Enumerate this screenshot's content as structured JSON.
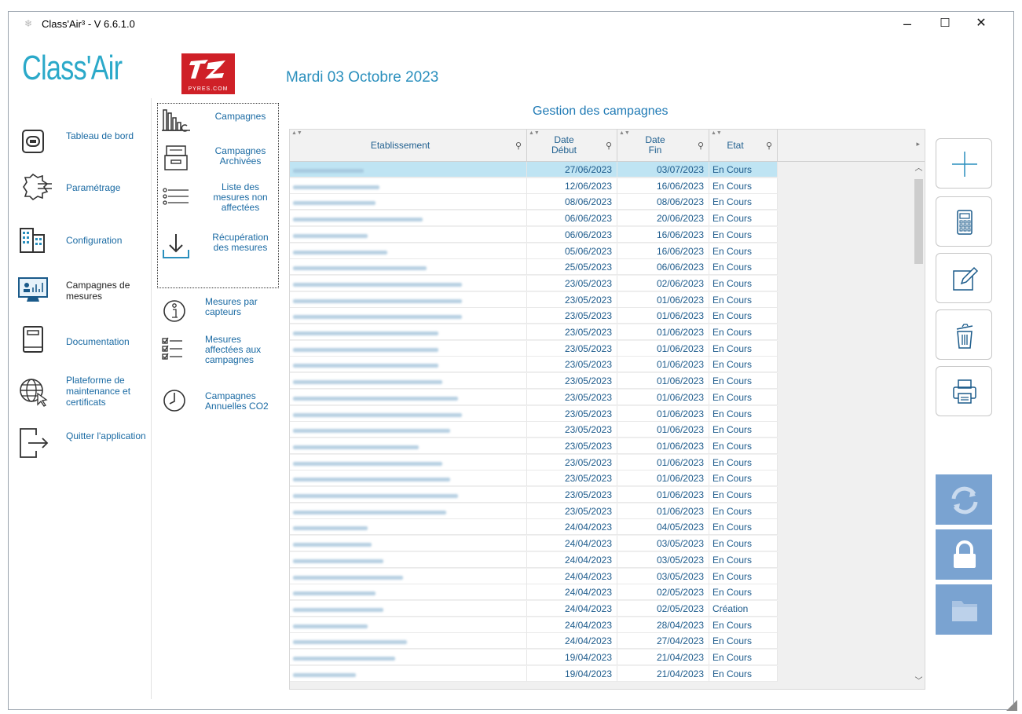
{
  "window": {
    "title": "Class'Air³ - V 6.6.1.0",
    "minimize": "–",
    "maximize": "☐",
    "close": "✕"
  },
  "logo": {
    "text": "Class'Air",
    "brand_sub": "PYRES.COM"
  },
  "date": "Mardi 03 Octobre 2023",
  "nav": [
    {
      "label": "Tableau de bord",
      "icon": "dashboard-icon"
    },
    {
      "label": "Paramétrage",
      "icon": "gear-icon"
    },
    {
      "label": "Configuration",
      "icon": "building-icon"
    },
    {
      "label": "Campagnes de mesures",
      "icon": "chart-monitor-icon"
    },
    {
      "label": "Documentation",
      "icon": "book-icon"
    },
    {
      "label": "Plateforme de maintenance et certificats",
      "icon": "globe-icon"
    },
    {
      "label": "Quitter l'application",
      "icon": "exit-icon"
    }
  ],
  "subnav": [
    {
      "label": "Campagnes",
      "icon": "bar-chart-icon"
    },
    {
      "label": "Campagnes Archivées",
      "icon": "archive-icon"
    },
    {
      "label": "Liste des mesures non affectées",
      "icon": "list-icon"
    },
    {
      "label": "Récupération des mesures",
      "icon": "download-icon"
    },
    {
      "label": "Mesures par capteurs",
      "icon": "sensor-icon"
    },
    {
      "label": "Mesures affectées aux campagnes",
      "icon": "checklist-icon"
    },
    {
      "label": "Campagnes Annuelles CO2",
      "icon": "clock-icon"
    }
  ],
  "grid": {
    "title": "Gestion des campagnes",
    "columns": [
      "Etablissement",
      "Date Début",
      "Date Fin",
      "Etat"
    ],
    "rows": [
      {
        "debut": "27/06/2023",
        "fin": "03/07/2023",
        "etat": "En Cours",
        "w": 90
      },
      {
        "debut": "12/06/2023",
        "fin": "16/06/2023",
        "etat": "En Cours",
        "w": 110
      },
      {
        "debut": "08/06/2023",
        "fin": "08/06/2023",
        "etat": "En Cours",
        "w": 105
      },
      {
        "debut": "06/06/2023",
        "fin": "20/06/2023",
        "etat": "En Cours",
        "w": 165
      },
      {
        "debut": "06/06/2023",
        "fin": "16/06/2023",
        "etat": "En Cours",
        "w": 95
      },
      {
        "debut": "05/06/2023",
        "fin": "16/06/2023",
        "etat": "En Cours",
        "w": 120
      },
      {
        "debut": "25/05/2023",
        "fin": "06/06/2023",
        "etat": "En Cours",
        "w": 170
      },
      {
        "debut": "23/05/2023",
        "fin": "02/06/2023",
        "etat": "En Cours",
        "w": 215
      },
      {
        "debut": "23/05/2023",
        "fin": "01/06/2023",
        "etat": "En Cours",
        "w": 215
      },
      {
        "debut": "23/05/2023",
        "fin": "01/06/2023",
        "etat": "En Cours",
        "w": 215
      },
      {
        "debut": "23/05/2023",
        "fin": "01/06/2023",
        "etat": "En Cours",
        "w": 185
      },
      {
        "debut": "23/05/2023",
        "fin": "01/06/2023",
        "etat": "En Cours",
        "w": 185
      },
      {
        "debut": "23/05/2023",
        "fin": "01/06/2023",
        "etat": "En Cours",
        "w": 185
      },
      {
        "debut": "23/05/2023",
        "fin": "01/06/2023",
        "etat": "En Cours",
        "w": 190
      },
      {
        "debut": "23/05/2023",
        "fin": "01/06/2023",
        "etat": "En Cours",
        "w": 210
      },
      {
        "debut": "23/05/2023",
        "fin": "01/06/2023",
        "etat": "En Cours",
        "w": 215
      },
      {
        "debut": "23/05/2023",
        "fin": "01/06/2023",
        "etat": "En Cours",
        "w": 200
      },
      {
        "debut": "23/05/2023",
        "fin": "01/06/2023",
        "etat": "En Cours",
        "w": 160
      },
      {
        "debut": "23/05/2023",
        "fin": "01/06/2023",
        "etat": "En Cours",
        "w": 190
      },
      {
        "debut": "23/05/2023",
        "fin": "01/06/2023",
        "etat": "En Cours",
        "w": 200
      },
      {
        "debut": "23/05/2023",
        "fin": "01/06/2023",
        "etat": "En Cours",
        "w": 210
      },
      {
        "debut": "23/05/2023",
        "fin": "01/06/2023",
        "etat": "En Cours",
        "w": 195
      },
      {
        "debut": "24/04/2023",
        "fin": "04/05/2023",
        "etat": "En Cours",
        "w": 95
      },
      {
        "debut": "24/04/2023",
        "fin": "03/05/2023",
        "etat": "En Cours",
        "w": 100
      },
      {
        "debut": "24/04/2023",
        "fin": "03/05/2023",
        "etat": "En Cours",
        "w": 115
      },
      {
        "debut": "24/04/2023",
        "fin": "03/05/2023",
        "etat": "En Cours",
        "w": 140
      },
      {
        "debut": "24/04/2023",
        "fin": "02/05/2023",
        "etat": "En Cours",
        "w": 105
      },
      {
        "debut": "24/04/2023",
        "fin": "02/05/2023",
        "etat": "Création",
        "w": 115
      },
      {
        "debut": "24/04/2023",
        "fin": "28/04/2023",
        "etat": "En Cours",
        "w": 95
      },
      {
        "debut": "24/04/2023",
        "fin": "27/04/2023",
        "etat": "En Cours",
        "w": 145
      },
      {
        "debut": "19/04/2023",
        "fin": "21/04/2023",
        "etat": "En Cours",
        "w": 130
      },
      {
        "debut": "19/04/2023",
        "fin": "21/04/2023",
        "etat": "En Cours",
        "w": 80
      }
    ]
  },
  "toolbar": [
    {
      "icon": "add-icon"
    },
    {
      "icon": "calculator-icon"
    },
    {
      "icon": "edit-icon"
    },
    {
      "icon": "trash-icon"
    },
    {
      "icon": "printer-icon"
    },
    {
      "icon": "refresh-icon"
    },
    {
      "icon": "lock-icon"
    },
    {
      "icon": "folder-icon"
    }
  ],
  "colors": {
    "accent": "#2a8fbd",
    "selected_row": "#bfe4f3",
    "tool_blue": "#7aa3d1",
    "brand_red": "#cf2027"
  }
}
